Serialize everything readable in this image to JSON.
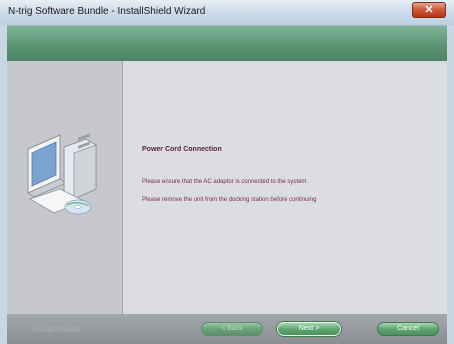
{
  "window": {
    "title": "N-trig Software Bundle - InstallShield Wizard",
    "close_glyph": "✕"
  },
  "main": {
    "heading": "Power Cord Connection",
    "messages": [
      "Please ensure that the AC adaptor is connected to the system.",
      "Please remove the unit from the docking station before continuing"
    ]
  },
  "footer": {
    "brand": "InstallShield",
    "back_label": "< Back",
    "next_label": "Next >",
    "cancel_label": "Cancel"
  },
  "colors": {
    "banner": "#5c9474",
    "heading": "#5a1f3e",
    "body_text": "#7a2b55",
    "button": "#5fa671"
  }
}
